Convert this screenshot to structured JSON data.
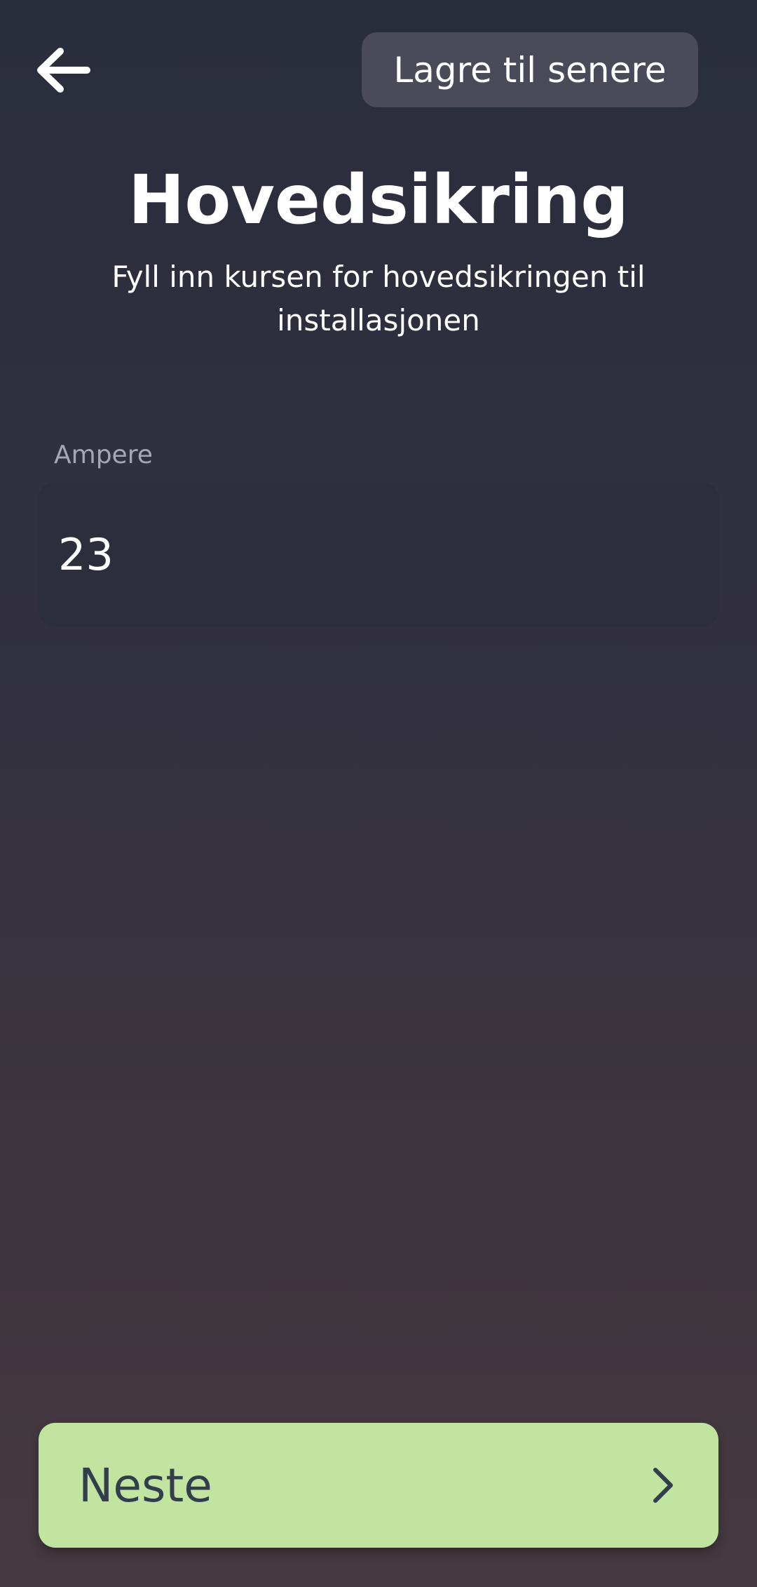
{
  "header": {
    "back_icon": "arrow-left-icon",
    "save_later_label": "Lagre til senere"
  },
  "main": {
    "title": "Hovedsikring",
    "subtitle": "Fyll inn kursen for hovedsikringen til installasjonen",
    "ampere_field": {
      "label": "Ampere",
      "value": "23"
    }
  },
  "footer": {
    "next_label": "Neste",
    "next_icon": "chevron-right-icon"
  },
  "colors": {
    "accent": "#c1e5a1",
    "accent_text": "#323e4c",
    "surface": "#2c2e3b",
    "secondary_button": "#4a4a58"
  }
}
